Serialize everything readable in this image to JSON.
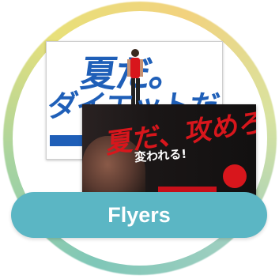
{
  "card": {
    "label": "Flyers",
    "accent_color": "#5bb6c4",
    "ring_colors": [
      "#7fc7b8",
      "#e8e07a",
      "#f2d27e"
    ]
  },
  "flyers": {
    "back": {
      "headline_line1": "夏だ。",
      "headline_line2": "ダイエットだ。",
      "primary_color": "#1f5fb8"
    },
    "front": {
      "headline": "夏だ、攻めろ。",
      "subline": "変われる!",
      "primary_color": "#d8161c"
    }
  }
}
